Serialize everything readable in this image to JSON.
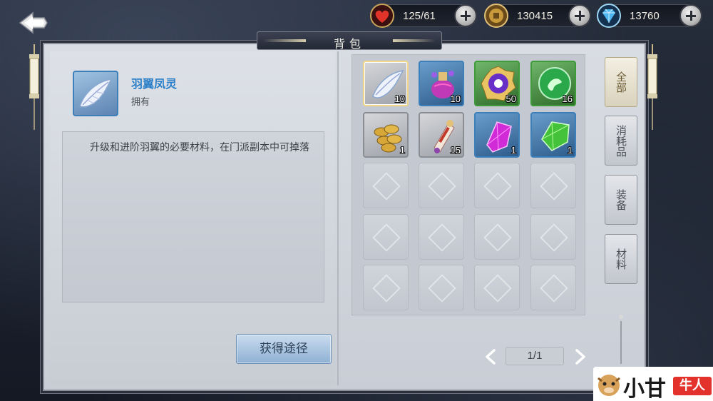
{
  "header": {
    "title": "背包",
    "currencies": [
      {
        "name": "stamina",
        "icon": "heart-icon",
        "value": "125/61",
        "color": "#e0342b"
      },
      {
        "name": "coins",
        "icon": "coin-icon",
        "value": "130415",
        "color": "#c99a3c"
      },
      {
        "name": "gems",
        "icon": "diamond-icon",
        "value": "13760",
        "color": "#4db5f0"
      }
    ]
  },
  "detail": {
    "item_name": "羽翼凤灵",
    "status": "拥有",
    "description": "升级和进阶羽翼的必要材料，在门派副本中可掉落",
    "acquire_label": "获得途径"
  },
  "inventory": {
    "slots": [
      {
        "item": "feather-icon",
        "quality": "gray",
        "count": "10",
        "selected": true
      },
      {
        "item": "potion-icon",
        "quality": "blue",
        "count": "10"
      },
      {
        "item": "compass-icon",
        "quality": "green",
        "count": "50"
      },
      {
        "item": "jade-orb-icon",
        "quality": "green",
        "count": "16"
      },
      {
        "item": "coins-stack-icon",
        "quality": "gray",
        "count": "1"
      },
      {
        "item": "scroll-icon",
        "quality": "gray",
        "count": "15"
      },
      {
        "item": "purple-crystal-icon",
        "quality": "blue",
        "count": "1"
      },
      {
        "item": "green-crystal-icon",
        "quality": "blue",
        "count": "1"
      }
    ],
    "total_slots": 20
  },
  "pager": {
    "text": "1/1"
  },
  "tabs": [
    {
      "label": "全部",
      "active": true
    },
    {
      "label": "消耗品",
      "active": false
    },
    {
      "label": "装备",
      "active": false
    },
    {
      "label": "材料",
      "active": false
    }
  ],
  "watermark": {
    "text": "小甘",
    "badge": "牛人"
  }
}
